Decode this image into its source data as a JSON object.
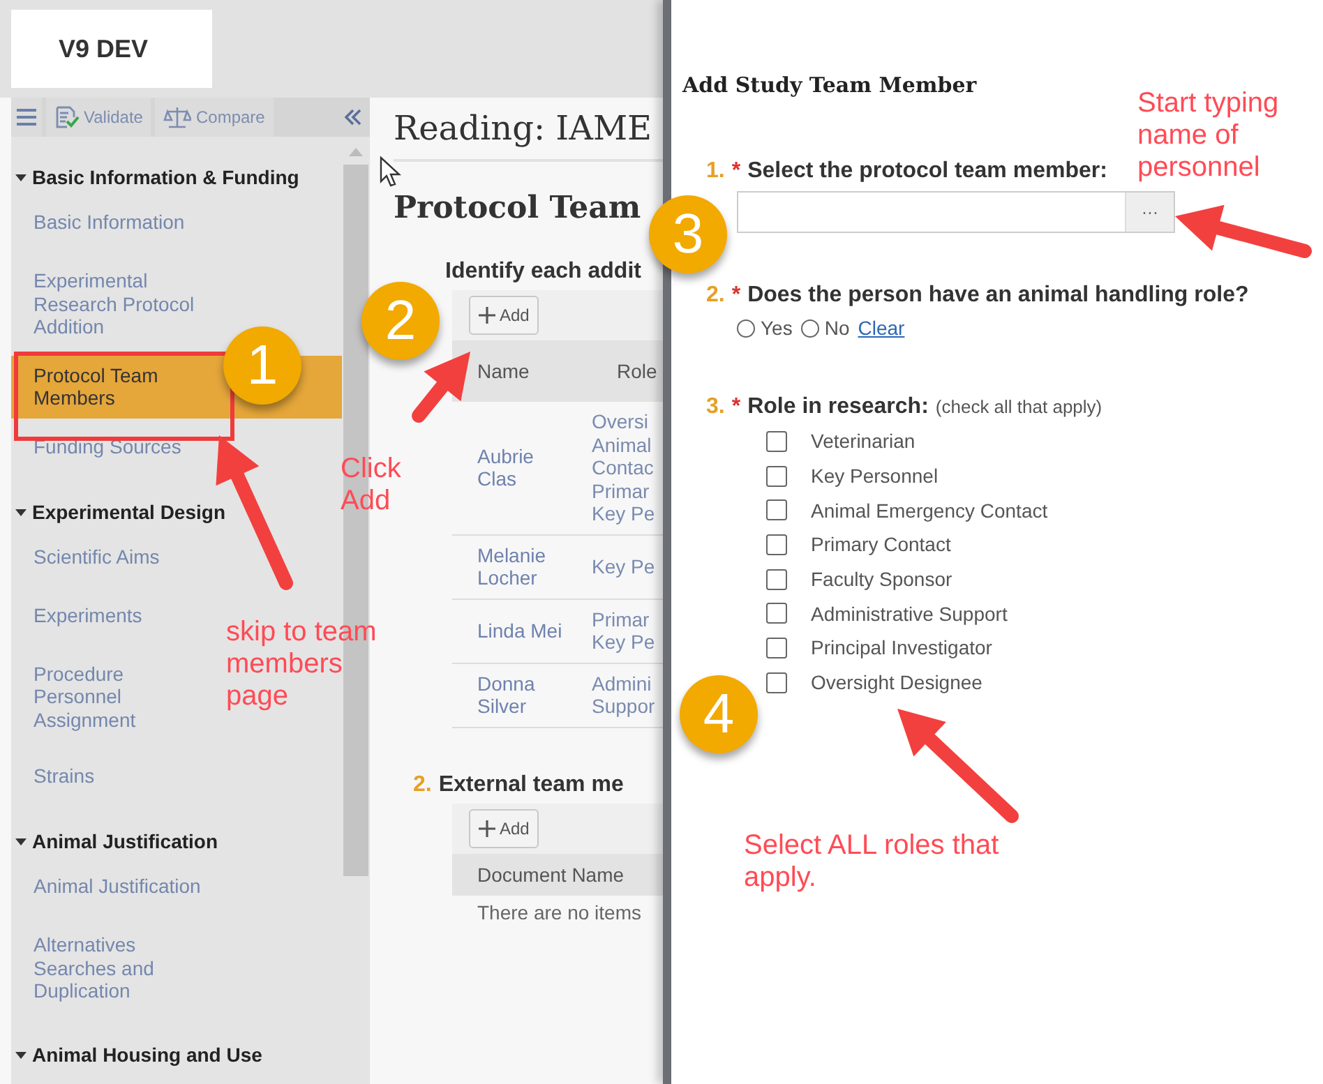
{
  "header": {
    "logo": "V9 DEV"
  },
  "toolbar": {
    "buttons": [
      {
        "label": "Validate",
        "kind": "validate"
      },
      {
        "label": "Compare",
        "kind": "compare"
      }
    ]
  },
  "sidebar": {
    "sections": [
      {
        "title": "Basic Information & Funding",
        "expanded": true,
        "items": [
          {
            "label": "Basic Information",
            "selected": false
          },
          {
            "label": "Experimental Research Protocol Addition",
            "selected": false
          },
          {
            "label": "Protocol Team Members",
            "selected": true
          },
          {
            "label": "Funding Sources",
            "selected": false
          }
        ]
      },
      {
        "title": "Experimental Design",
        "expanded": true,
        "items": [
          {
            "label": "Scientific Aims",
            "selected": false
          },
          {
            "label": "Experiments",
            "selected": false
          },
          {
            "label": "Procedure Personnel Assignment",
            "selected": false
          },
          {
            "label": "Strains",
            "selected": false
          }
        ]
      },
      {
        "title": "Animal Justification",
        "expanded": true,
        "items": [
          {
            "label": "Animal Justification",
            "selected": false
          },
          {
            "label": "Alternatives Searches and Duplication",
            "selected": false
          }
        ]
      },
      {
        "title": "Animal Housing and Use",
        "expanded": true
      }
    ]
  },
  "main": {
    "title": "Reading: IAME",
    "heading": "Protocol Team",
    "questions": [
      {
        "text": "Identify each addit",
        "add_label": "Add",
        "table": {
          "columns": [
            "Name",
            "Role"
          ],
          "rows": [
            {
              "name": "Aubrie Clas",
              "role": [
                "Oversi",
                "Animal",
                "Contac",
                "Primar",
                "Key Pe"
              ]
            },
            {
              "name": "Melanie Locher",
              "role": [
                "Key Pe"
              ]
            },
            {
              "name": "Linda Mei",
              "role": [
                "Primar",
                "Key Pe"
              ]
            },
            {
              "name": "Donna Silver",
              "role": [
                "Admini",
                "Suppor"
              ]
            }
          ]
        }
      },
      {
        "number": "2.",
        "text": "External team me",
        "add_label": "Add",
        "table": {
          "columns": [
            "Document Name"
          ],
          "empty": "There are no items"
        }
      }
    ]
  },
  "panel": {
    "title": "Add Study Team Member",
    "questions": [
      {
        "number": "1.",
        "mark": "*",
        "kind": "lookup",
        "label": "Select the protocol team member:",
        "button": "···"
      },
      {
        "number": "2.",
        "mark": "*",
        "kind": "radio",
        "label": "Does the person have an animal handling role?",
        "options": [
          {
            "label": "Yes",
            "selected": false
          },
          {
            "label": "No",
            "selected": false
          }
        ],
        "clear": "Clear"
      },
      {
        "number": "3.",
        "mark": "*",
        "kind": "checklist",
        "label": "Role in research:",
        "hint": "(check all that apply)",
        "options": [
          {
            "label": "Veterinarian",
            "checked": false
          },
          {
            "label": "Key Personnel",
            "checked": false
          },
          {
            "label": "Animal Emergency Contact",
            "checked": false
          },
          {
            "label": "Primary Contact",
            "checked": false
          },
          {
            "label": "Faculty Sponsor",
            "checked": false
          },
          {
            "label": "Administrative Support",
            "checked": false
          },
          {
            "label": "Principal Investigator",
            "checked": false
          },
          {
            "label": "Oversight Designee",
            "checked": false
          }
        ]
      }
    ]
  },
  "annotations": {
    "badges": [
      "1",
      "2",
      "3",
      "4"
    ],
    "notes": [
      "Click Add",
      "skip to team members page",
      "Start typing name of personnel",
      "Select ALL roles that apply."
    ]
  }
}
